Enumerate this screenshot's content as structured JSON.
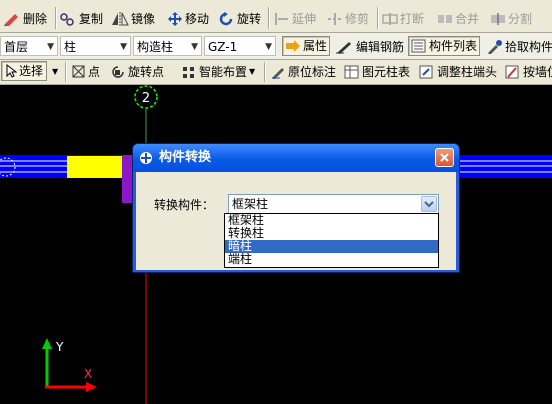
{
  "toolbar1": {
    "delete_label": "删除",
    "copy_label": "复制",
    "mirror_label": "镜像",
    "move_label": "移动",
    "rotate_label": "旋转",
    "extend_label": "延伸",
    "trim_label": "修剪",
    "break_label": "打断",
    "merge_label": "合并",
    "split_label": "分割"
  },
  "toolbar2": {
    "floor_select": "首层",
    "type_select": "柱",
    "subtype_select": "构造柱",
    "element_select": "GZ-1",
    "properties_label": "属性",
    "edit_rebar_label": "编辑钢筋",
    "component_list_label": "构件列表",
    "pick_component_label": "拾取构件"
  },
  "toolbar3": {
    "select_label": "选择",
    "point_label": "点",
    "rotate_point_label": "旋转点",
    "smart_layout_label": "智能布置",
    "origin_mark_label": "原位标注",
    "column_table_label": "图元柱表",
    "adjust_end_label": "调整柱端头",
    "by_wall_label": "按墙位"
  },
  "canvas": {
    "axis_number": "2",
    "axis_y_label": "Y",
    "axis_x_label": "X",
    "colors": {
      "beam": "#0000ff",
      "column": "#ffff00",
      "grid_line": "#ff0000",
      "axis_circle": "#00ff00"
    }
  },
  "dialog": {
    "title": "构件转换",
    "field_label": "转换构件：",
    "selected": "框架柱",
    "options": [
      "框架柱",
      "转换柱",
      "暗柱",
      "端柱"
    ],
    "highlighted_option": "暗柱"
  }
}
